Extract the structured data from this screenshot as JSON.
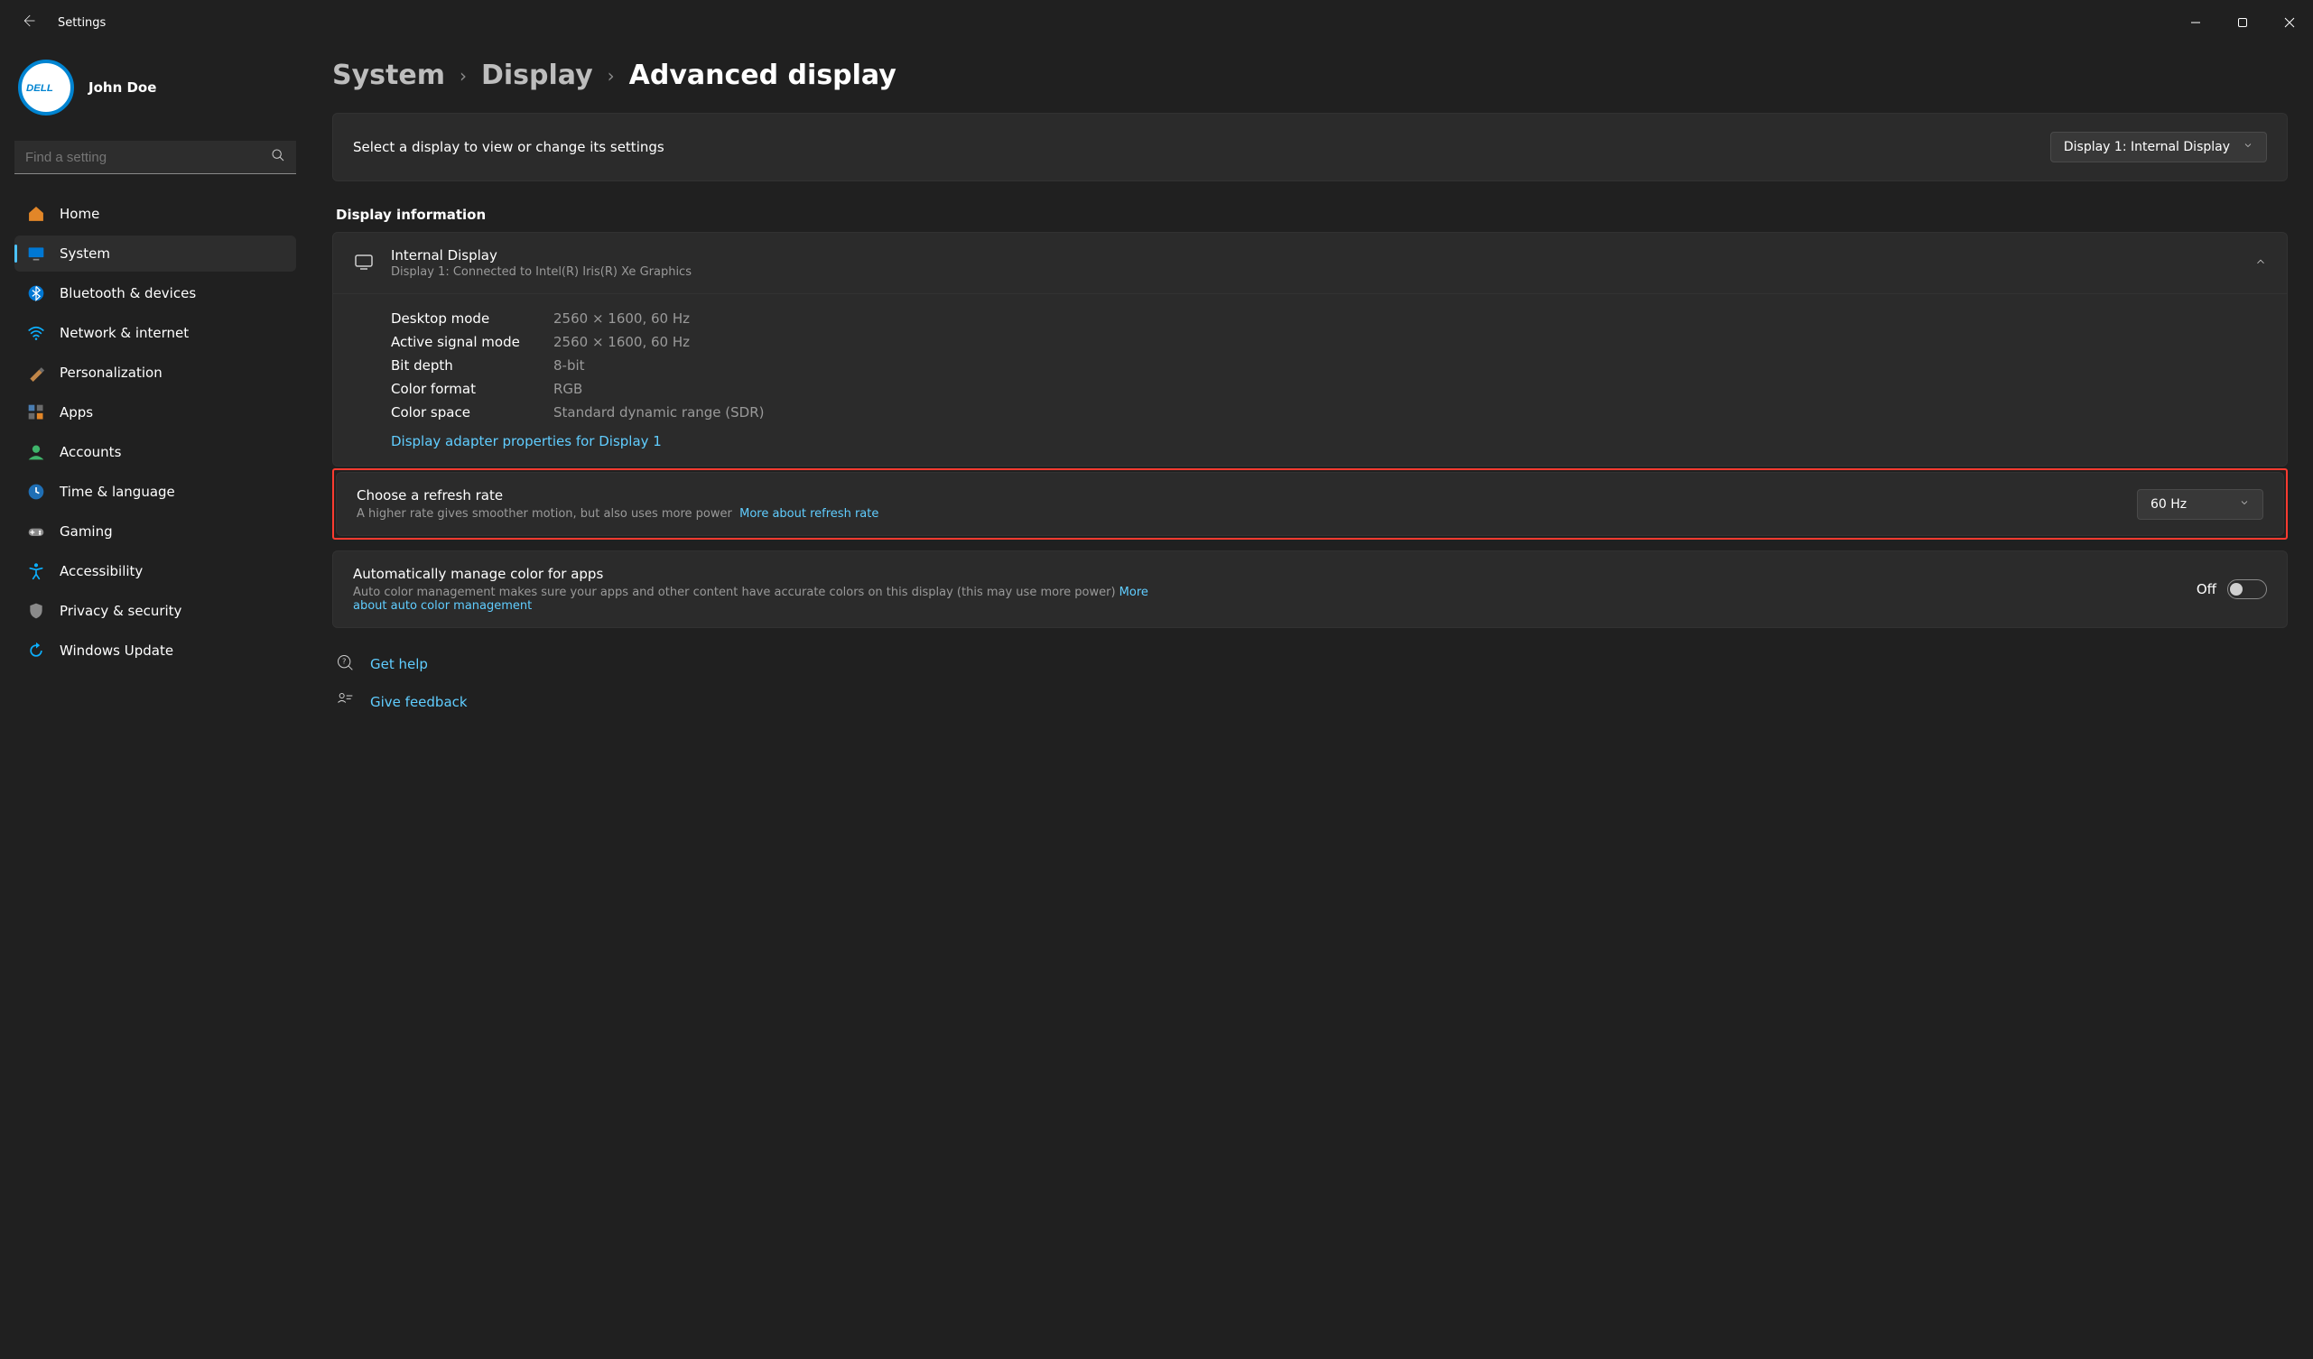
{
  "app": {
    "title": "Settings"
  },
  "user": {
    "name": "John Doe",
    "avatar_text": "DELL"
  },
  "search": {
    "placeholder": "Find a setting"
  },
  "sidebar": {
    "items": [
      {
        "label": "Home"
      },
      {
        "label": "System"
      },
      {
        "label": "Bluetooth & devices"
      },
      {
        "label": "Network & internet"
      },
      {
        "label": "Personalization"
      },
      {
        "label": "Apps"
      },
      {
        "label": "Accounts"
      },
      {
        "label": "Time & language"
      },
      {
        "label": "Gaming"
      },
      {
        "label": "Accessibility"
      },
      {
        "label": "Privacy & security"
      },
      {
        "label": "Windows Update"
      }
    ],
    "active_index": 1
  },
  "breadcrumb": {
    "l0": "System",
    "l1": "Display",
    "l2": "Advanced display"
  },
  "select_display": {
    "prompt": "Select a display to view or change its settings",
    "selected": "Display 1: Internal Display"
  },
  "section_heading": "Display information",
  "display_info": {
    "title": "Internal Display",
    "subtitle": "Display 1: Connected to Intel(R) Iris(R) Xe Graphics",
    "specs": [
      {
        "k": "Desktop mode",
        "v": "2560 × 1600, 60 Hz"
      },
      {
        "k": "Active signal mode",
        "v": "2560 × 1600, 60 Hz"
      },
      {
        "k": "Bit depth",
        "v": "8-bit"
      },
      {
        "k": "Color format",
        "v": "RGB"
      },
      {
        "k": "Color space",
        "v": "Standard dynamic range (SDR)"
      }
    ],
    "adapter_link": "Display adapter properties for Display 1"
  },
  "refresh_rate": {
    "title": "Choose a refresh rate",
    "subtitle": "A higher rate gives smoother motion, but also uses more power",
    "more_link": "More about refresh rate",
    "selected": "60 Hz"
  },
  "auto_color": {
    "title": "Automatically manage color for apps",
    "subtitle": "Auto color management makes sure your apps and other content have accurate colors on this display (this may use more power)",
    "more_link": "More about auto color management",
    "state": "Off"
  },
  "help": {
    "get_help": "Get help",
    "feedback": "Give feedback"
  }
}
